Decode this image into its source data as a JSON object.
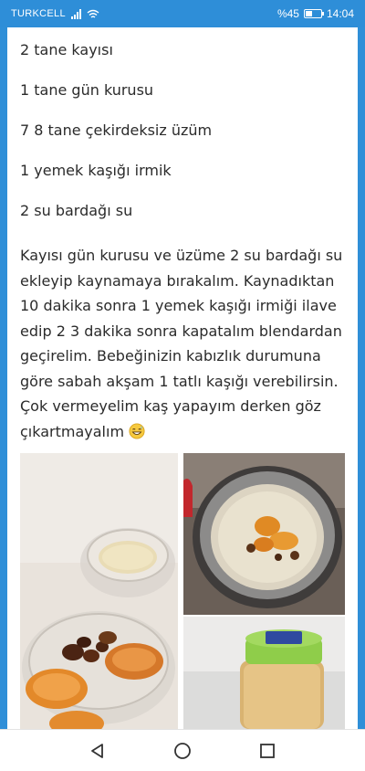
{
  "status_bar": {
    "carrier": "TURKCELL",
    "battery_text": "%45",
    "battery_level": 0.45,
    "time": "14:04"
  },
  "ingredients": [
    "2 tane kayısı",
    "1 tane gün kurusu",
    "7 8 tane çekirdeksiz üzüm",
    "1 yemek kaşığı irmik",
    "2 su bardağı su"
  ],
  "instructions": {
    "text": "Kayısı gün kurusu ve üzüme 2 su bardağı su ekleyip kaynamaya bırakalım. Kaynadıktan 10 dakika sonra 1 yemek kaşığı irmiği ilave edip 2 3 dakika sonra kapatalım blendardan geçirelim. Bebeğinizin kabızlık durumuna göre sabah akşam 1 tatlı kaşığı verebilirsin. Çok vermeyelim kaş yapayım derken göz çıkartmayalım",
    "emoji": "grinning-sweat-emoji"
  },
  "photos": [
    {
      "name": "ingredients-photo",
      "icon": "photo-ingredients-bowl"
    },
    {
      "name": "cooking-pot-photo",
      "icon": "photo-pot"
    },
    {
      "name": "jar-photo",
      "icon": "photo-jar"
    }
  ],
  "nav_bar": {
    "back_icon": "back-triangle-icon",
    "home_icon": "home-circle-icon",
    "recents_icon": "recents-square-icon"
  },
  "colors": {
    "status_bar": "#2e8ed8",
    "text": "#2b2b2b",
    "background": "#ffffff"
  }
}
